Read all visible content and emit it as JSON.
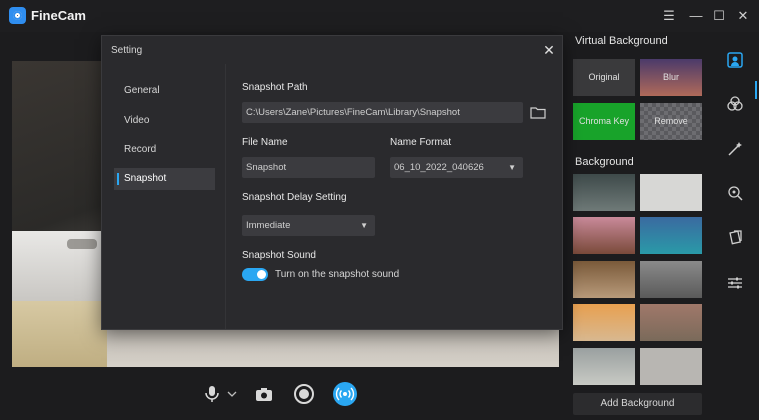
{
  "app": {
    "title": "FineCam"
  },
  "window_controls": {
    "menu": "☰",
    "minimize": "—",
    "maximize": "☐",
    "close": "✕"
  },
  "settings": {
    "title": "Setting",
    "close": "✕",
    "nav": [
      {
        "label": "General",
        "active": false
      },
      {
        "label": "Video",
        "active": false
      },
      {
        "label": "Record",
        "active": false
      },
      {
        "label": "Snapshot",
        "active": true
      }
    ],
    "snapshot": {
      "path_label": "Snapshot Path",
      "path_value": "C:\\Users\\Zane\\Pictures\\FineCam\\Library\\Snapshot",
      "file_name_label": "File Name",
      "file_name_value": "Snapshot",
      "name_format_label": "Name Format",
      "name_format_value": "06_10_2022_040626",
      "delay_label": "Snapshot Delay Setting",
      "delay_value": "Immediate",
      "sound_label": "Snapshot Sound",
      "sound_toggle_label": "Turn on the snapshot sound",
      "sound_on": true
    }
  },
  "right_panel": {
    "virtual_background_title": "Virtual Background",
    "virtual_options": [
      {
        "label": "Original",
        "color": "#3a3a3c"
      },
      {
        "label": "Blur",
        "color": "#7a4a6a"
      },
      {
        "label": "Chroma Key",
        "color": "#18a32a"
      },
      {
        "label": "Remove",
        "color": "#5a5a5e"
      }
    ],
    "background_title": "Background",
    "add_background_label": "Add Background"
  },
  "icons": {
    "mic": "mic-icon",
    "camera": "camera-icon",
    "record": "record-icon",
    "live": "live-broadcast-icon",
    "folder": "folder-icon"
  },
  "colors": {
    "accent": "#2aa7f2",
    "panel": "#2a2a2d",
    "background": "#1c1c1e"
  }
}
